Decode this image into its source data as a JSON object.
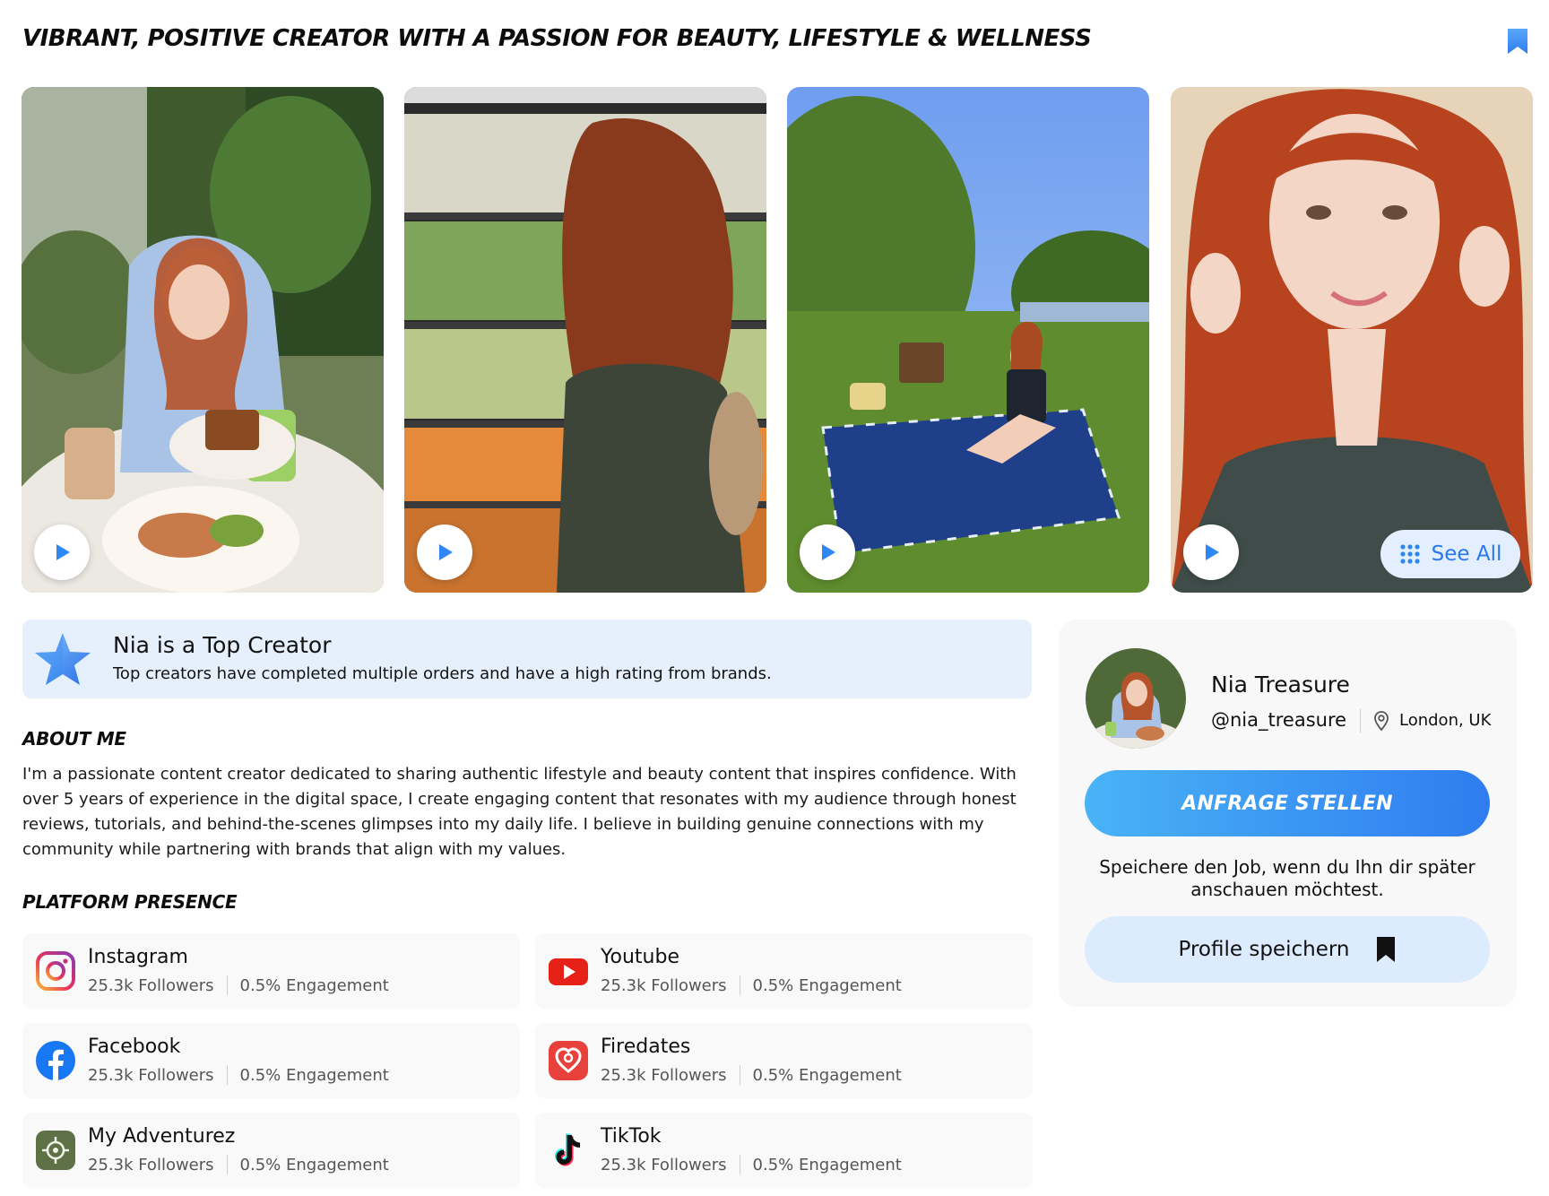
{
  "headline": "VIBRANT, POSITIVE CREATOR WITH A PASSION FOR BEAUTY, LIFESTYLE & WELLNESS",
  "gallery": {
    "see_all_label": "See All"
  },
  "top_creator": {
    "title": "Nia is a Top Creator",
    "subtitle": "Top creators have completed multiple orders and have a high rating from brands."
  },
  "about": {
    "heading": "ABOUT ME",
    "text": "I'm a passionate content creator dedicated to sharing authentic lifestyle and beauty content that inspires confidence. With over 5 years of experience in the digital space, I create engaging content that resonates with my audience through honest reviews, tutorials, and behind-the-scenes glimpses into my daily life. I believe in building genuine connections with my community while partnering with brands that align with my values."
  },
  "platforms": {
    "heading": "PLATFORM PRESENCE",
    "items": [
      {
        "name": "Instagram",
        "followers": "25.3k Followers",
        "engagement": "0.5% Engagement",
        "icon": "instagram-icon"
      },
      {
        "name": "Youtube",
        "followers": "25.3k Followers",
        "engagement": "0.5% Engagement",
        "icon": "youtube-icon"
      },
      {
        "name": "Facebook",
        "followers": "25.3k Followers",
        "engagement": "0.5% Engagement",
        "icon": "facebook-icon"
      },
      {
        "name": "Firedates",
        "followers": "25.3k Followers",
        "engagement": "0.5% Engagement",
        "icon": "firedates-icon"
      },
      {
        "name": "My Adventurez",
        "followers": "25.3k Followers",
        "engagement": "0.5% Engagement",
        "icon": "my-adventurez-icon"
      },
      {
        "name": "TikTok",
        "followers": "25.3k Followers",
        "engagement": "0.5% Engagement",
        "icon": "tiktok-icon"
      }
    ]
  },
  "profile": {
    "name": "Nia Treasure",
    "handle": "@nia_treasure",
    "location": "London, UK",
    "cta_label": "ANFRAGE STELLEN",
    "save_hint": "Speichere den Job, wenn du Ihn dir später anschauen möchtest.",
    "save_label": "Profile speichern"
  },
  "colors": {
    "accent": "#2f7cf0",
    "accent_light": "#49b3f6",
    "banner_bg": "#e6f0fd",
    "save_bg": "#dcebfd"
  }
}
